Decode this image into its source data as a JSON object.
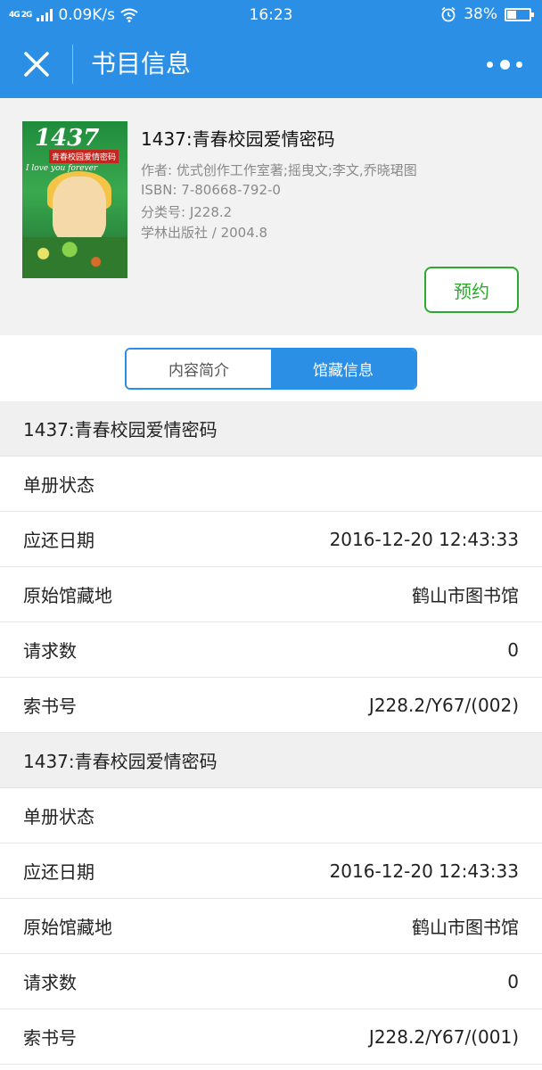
{
  "status_bar": {
    "signal_text": "4G 2G",
    "network_speed": "0.09K/s",
    "time": "16:23",
    "battery": "38%",
    "battery_level": 0.38
  },
  "header": {
    "title": "书目信息"
  },
  "book": {
    "title": "1437:青春校园爱情密码",
    "author": "作者: 优式创作工作室著;摇曳文;李文,乔晓珺图",
    "isbn": "ISBN: 7-80668-792-0",
    "classification": "分类号: J228.2",
    "publisher": "学林出版社 / 2004.8",
    "reserve_label": "预约",
    "cover": {
      "number": "1437",
      "subtitle": "青春校园爱情密码",
      "tagline": "I love you forever"
    }
  },
  "tabs": [
    {
      "label": "内容简介",
      "active": false
    },
    {
      "label": "馆藏信息",
      "active": true
    }
  ],
  "holdings": [
    {
      "title": "1437:青春校园爱情密码",
      "rows": [
        {
          "label": "单册状态",
          "value": ""
        },
        {
          "label": "应还日期",
          "value": "2016-12-20 12:43:33"
        },
        {
          "label": "原始馆藏地",
          "value": "鹤山市图书馆"
        },
        {
          "label": "请求数",
          "value": "0"
        },
        {
          "label": "索书号",
          "value": "J228.2/Y67/(002)"
        }
      ]
    },
    {
      "title": "1437:青春校园爱情密码",
      "rows": [
        {
          "label": "单册状态",
          "value": ""
        },
        {
          "label": "应还日期",
          "value": "2016-12-20 12:43:33"
        },
        {
          "label": "原始馆藏地",
          "value": "鹤山市图书馆"
        },
        {
          "label": "请求数",
          "value": "0"
        },
        {
          "label": "索书号",
          "value": "J228.2/Y67/(001)"
        }
      ]
    }
  ],
  "colors": {
    "primary": "#2b8fe5",
    "reserve_green": "#2fa82f",
    "section_bg": "#f2f2f2"
  }
}
